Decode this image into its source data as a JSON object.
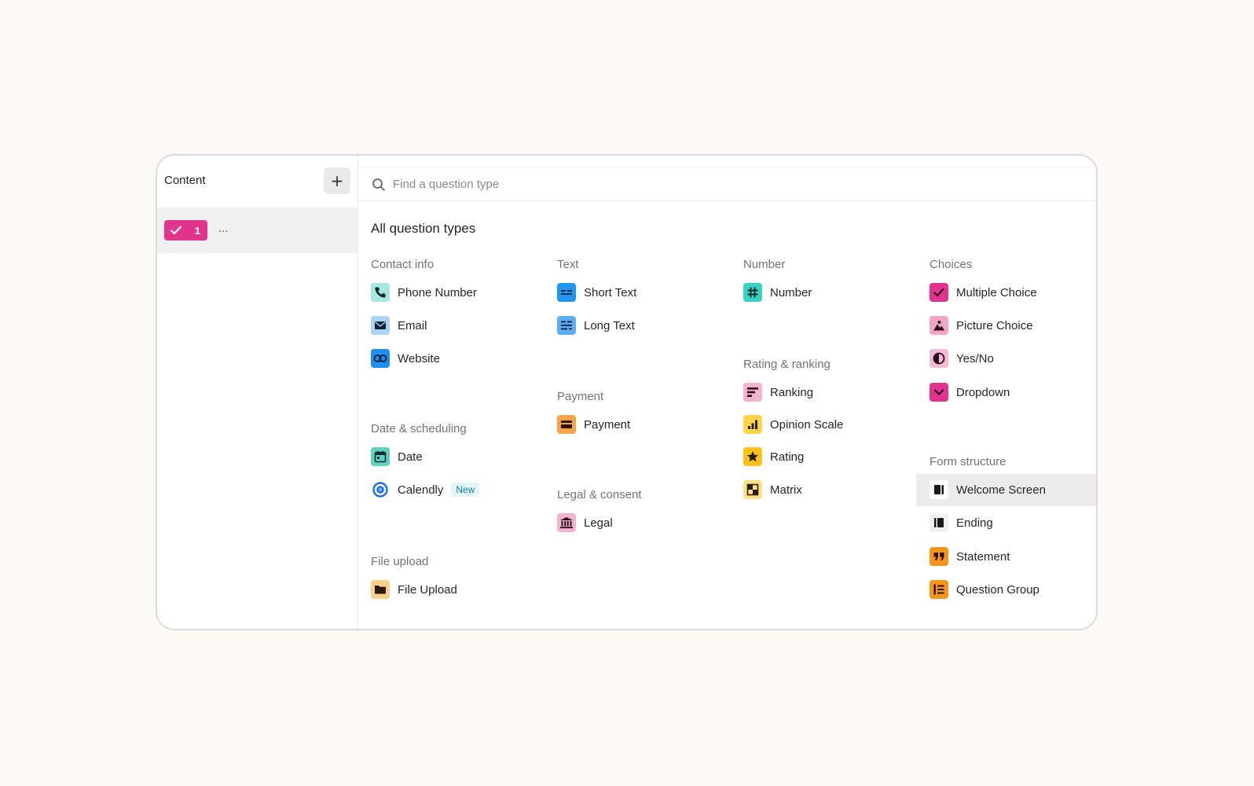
{
  "sidebar": {
    "title": "Content",
    "add_label": "+",
    "question": {
      "number": "1",
      "ellipsis": "..."
    }
  },
  "search": {
    "placeholder": "Find a question type",
    "value": ""
  },
  "panel": {
    "title": "All question types"
  },
  "categories": {
    "contact": "Contact info",
    "text": "Text",
    "number": "Number",
    "choices": "Choices",
    "rating": "Rating & ranking",
    "payment": "Payment",
    "date": "Date & scheduling",
    "structure": "Form structure",
    "legal": "Legal & consent",
    "file": "File upload"
  },
  "types": {
    "phone": "Phone Number",
    "email": "Email",
    "website": "Website",
    "short_text": "Short Text",
    "long_text": "Long Text",
    "number": "Number",
    "multiple_choice": "Multiple Choice",
    "picture_choice": "Picture Choice",
    "yes_no": "Yes/No",
    "dropdown": "Dropdown",
    "ranking": "Ranking",
    "opinion_scale": "Opinion Scale",
    "rating": "Rating",
    "matrix": "Matrix",
    "payment": "Payment",
    "date": "Date",
    "calendly": "Calendly",
    "calendly_badge": "New",
    "legal": "Legal",
    "welcome_screen": "Welcome Screen",
    "ending": "Ending",
    "statement": "Statement",
    "question_group": "Question Group",
    "file_upload": "File Upload"
  },
  "colors": {
    "background": "#fdf9f4",
    "contact": "#a8e6e0",
    "email": "#a9d4f5",
    "website": "#1f8ef1",
    "text": "#2196f3",
    "number": "#3ad3c3",
    "choices": "#e0348f",
    "picture_choice": "#f4a6c6",
    "yes_no": "#f7b9d4",
    "ranking": "#f4b4cf",
    "opinion_scale": "#ffd54a",
    "rating": "#ffc21a",
    "matrix": "#fde08a",
    "payment": "#f7a445",
    "date": "#5fd2c0",
    "legal": "#f4b4cf",
    "structure_light": "#f1f1f1",
    "statement": "#f7941d",
    "file_upload": "#fbcf8c",
    "new_badge": "#0e7f92"
  },
  "icons": {
    "phone": "phone-icon",
    "email": "envelope-icon",
    "website": "link-icon",
    "short_text": "short-text-icon",
    "long_text": "long-text-icon",
    "number": "hash-icon",
    "multiple_choice": "check-icon",
    "picture_choice": "picture-icon",
    "yes_no": "half-circle-icon",
    "dropdown": "chevron-down-icon",
    "ranking": "ranking-bars-icon",
    "opinion_scale": "bar-chart-icon",
    "rating": "star-icon",
    "matrix": "matrix-grid-icon",
    "payment": "credit-card-icon",
    "date": "calendar-icon",
    "calendly": "calendly-logo-icon",
    "legal": "bank-icon",
    "welcome_screen": "welcome-screen-icon",
    "ending": "ending-screen-icon",
    "statement": "quote-icon",
    "question_group": "list-group-icon",
    "file_upload": "folder-icon",
    "search": "search-icon"
  }
}
